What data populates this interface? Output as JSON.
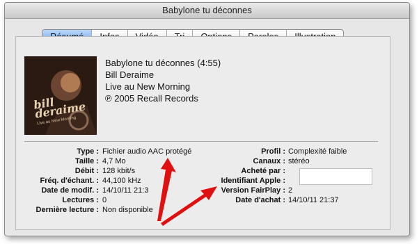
{
  "window": {
    "title": "Babylone tu déconnes"
  },
  "tabs": [
    "Résumé",
    "Infos",
    "Vidéo",
    "Tri",
    "Options",
    "Paroles",
    "Illustration"
  ],
  "track": {
    "title_line": "Babylone tu déconnes (4:55)",
    "artist": "Bill Deraime",
    "album": "Live au New Morning",
    "copyright": "℗ 2005 Recall Records"
  },
  "artwork": {
    "name_top": "bill",
    "name_bottom": "deraime",
    "subtitle": "Live au New Morning"
  },
  "left_info": [
    {
      "label": "Type :",
      "value": "Fichier audio AAC protégé"
    },
    {
      "label": "Taille :",
      "value": "4,7 Mo"
    },
    {
      "label": "Débit :",
      "value": "128 kbit/s"
    },
    {
      "label": "Fréq. d'échant. :",
      "value": "44,100 kHz"
    },
    {
      "label": "Date de modif. :",
      "value": "14/10/11 21:3"
    },
    {
      "label": "Lectures :",
      "value": "0"
    },
    {
      "label": "Dernière lecture :",
      "value": "Non disponible"
    }
  ],
  "right_info": [
    {
      "label": "Profil :",
      "value": "Complexité faible"
    },
    {
      "label": "Canaux :",
      "value": "stéréo"
    },
    {
      "label": "Acheté par :",
      "value": ""
    },
    {
      "label": "Identifiant Apple :",
      "value": ""
    },
    {
      "label": "Version FairPlay :",
      "value": "2"
    },
    {
      "label": "Date d'achat :",
      "value": "14/10/11 21:37"
    }
  ],
  "colors": {
    "arrow": "#e01010",
    "active_tab": "#6fa6ee"
  }
}
